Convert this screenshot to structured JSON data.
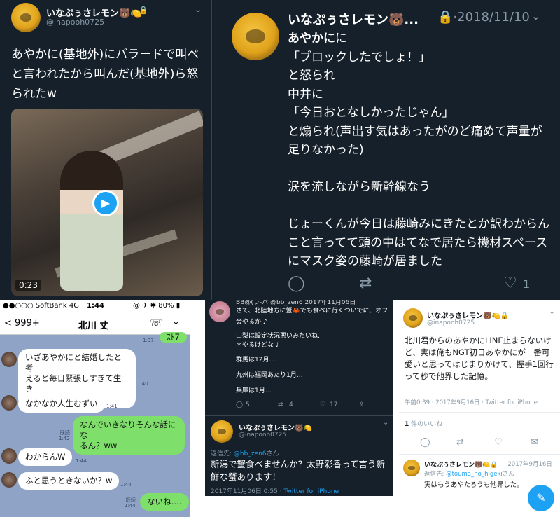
{
  "tweet_a": {
    "name": "いなぷぅさレモン🐻🍋",
    "lock": "🔒",
    "handle": "@inapooh0725",
    "chevron": "⌄",
    "body": "あやかに(基地外)にバラードで叫べと言われたから叫んだ(基地外)ら怒られたw",
    "video_time": "0:23"
  },
  "tweet_b": {
    "name": "いなぷぅさレモン🐻...",
    "date": "🔒·2018/11/10",
    "chevron": "⌄",
    "body_lead": "あやかに",
    "body_rest": "に\n「ブロックしたでしょ！」\nと怒られ\n中井に\n「今日おとなしかったじゃん」\nと煽られ(声出す気はあったがのど痛めて声量が足りなかった)\n\n涙を流しながら新幹線なう\n\nじょーくんが今日は藤崎みにきたとか訳わからんこと言ってて頭の中はてなで居たら機材スペースにマスク姿の藤崎が居ました",
    "like_count": "1"
  },
  "line": {
    "carrier": "●●○○○ SoftBank  4G",
    "time": "1:44",
    "battery": "@ ✈ ✱ 80% ▮",
    "back": "< 999+",
    "contact": "北川 丈",
    "messages": [
      {
        "dir": "out",
        "text": "ｽﾄ7",
        "ts": "1:37"
      },
      {
        "dir": "in",
        "text": "いざあやかにと結婚したと考\nえると毎日緊張しすぎて生き\nるの辛そうやな",
        "ts": "1:40"
      },
      {
        "dir": "in",
        "text": "なかなか人生むずい",
        "ts": "1:41"
      },
      {
        "dir": "out",
        "text": "なんでいきなりそんな話にな\nるん？ww",
        "ts": "既読\n1:42"
      },
      {
        "dir": "in",
        "text": "わからんW",
        "ts": "1:44"
      },
      {
        "dir": "in",
        "text": "ふと思うときないか？w",
        "ts": "1:44"
      },
      {
        "dir": "out",
        "text": "ないね….",
        "ts": "既読\n1:44"
      }
    ]
  },
  "tweet_d": {
    "top_header": "BB@(ラ-パ   @bb_zen6   2017年11月06日",
    "top_body": "さて、北陸地方に蟹🦀でも食べに行くついでに、オフ\n会やるか ♪",
    "quote_lines": [
      "山梨は設定状況悪いみたいね…",
      "＊やるけどな ♪",
      "群馬は12月…",
      "九州は福岡あたり1月…",
      "兵庫は1月…"
    ],
    "top_counts": {
      "reply": "5",
      "retweet": "4",
      "like": "17"
    },
    "name": "いなぷぅさレモン🐻🍋",
    "handle": "@inapooh0725",
    "reply_to_prefix": "返信先: ",
    "reply_to": "@bb_zen6",
    "reply_to_suffix": "さん",
    "body": "新潟で蟹食べませんか？太野彩香って言う新鮮な蟹あります！",
    "meta_time": "2017年11月06日 0:55 · ",
    "meta_via": "Twitter for iPhone"
  },
  "tweet_e": {
    "name": "いなぷぅさレモン🐻🍋🔒",
    "handle": "@inapooh0725",
    "body": "北川君からのあやかにLINE止まらないけど、実は俺もNGT初日あやかにが一番可愛いと思ってはじまりかけて、握手1回行って秒で他界した記憶。",
    "meta_time": "午前0:39 · 2017年9月16日 · ",
    "meta_via": "Twitter for iPhone",
    "likes_count": "1",
    "likes_label": "件のいいね",
    "reply_name": "いなぷぅさレモン🐻🍋🔒",
    "reply_date": "· 2017年9月16日",
    "reply_to_prefix": "返信先: ",
    "reply_to": "@touma_no_higeki",
    "reply_to_suffix": "さん",
    "reply_body": "実はもうあやたろうも他界した。"
  }
}
